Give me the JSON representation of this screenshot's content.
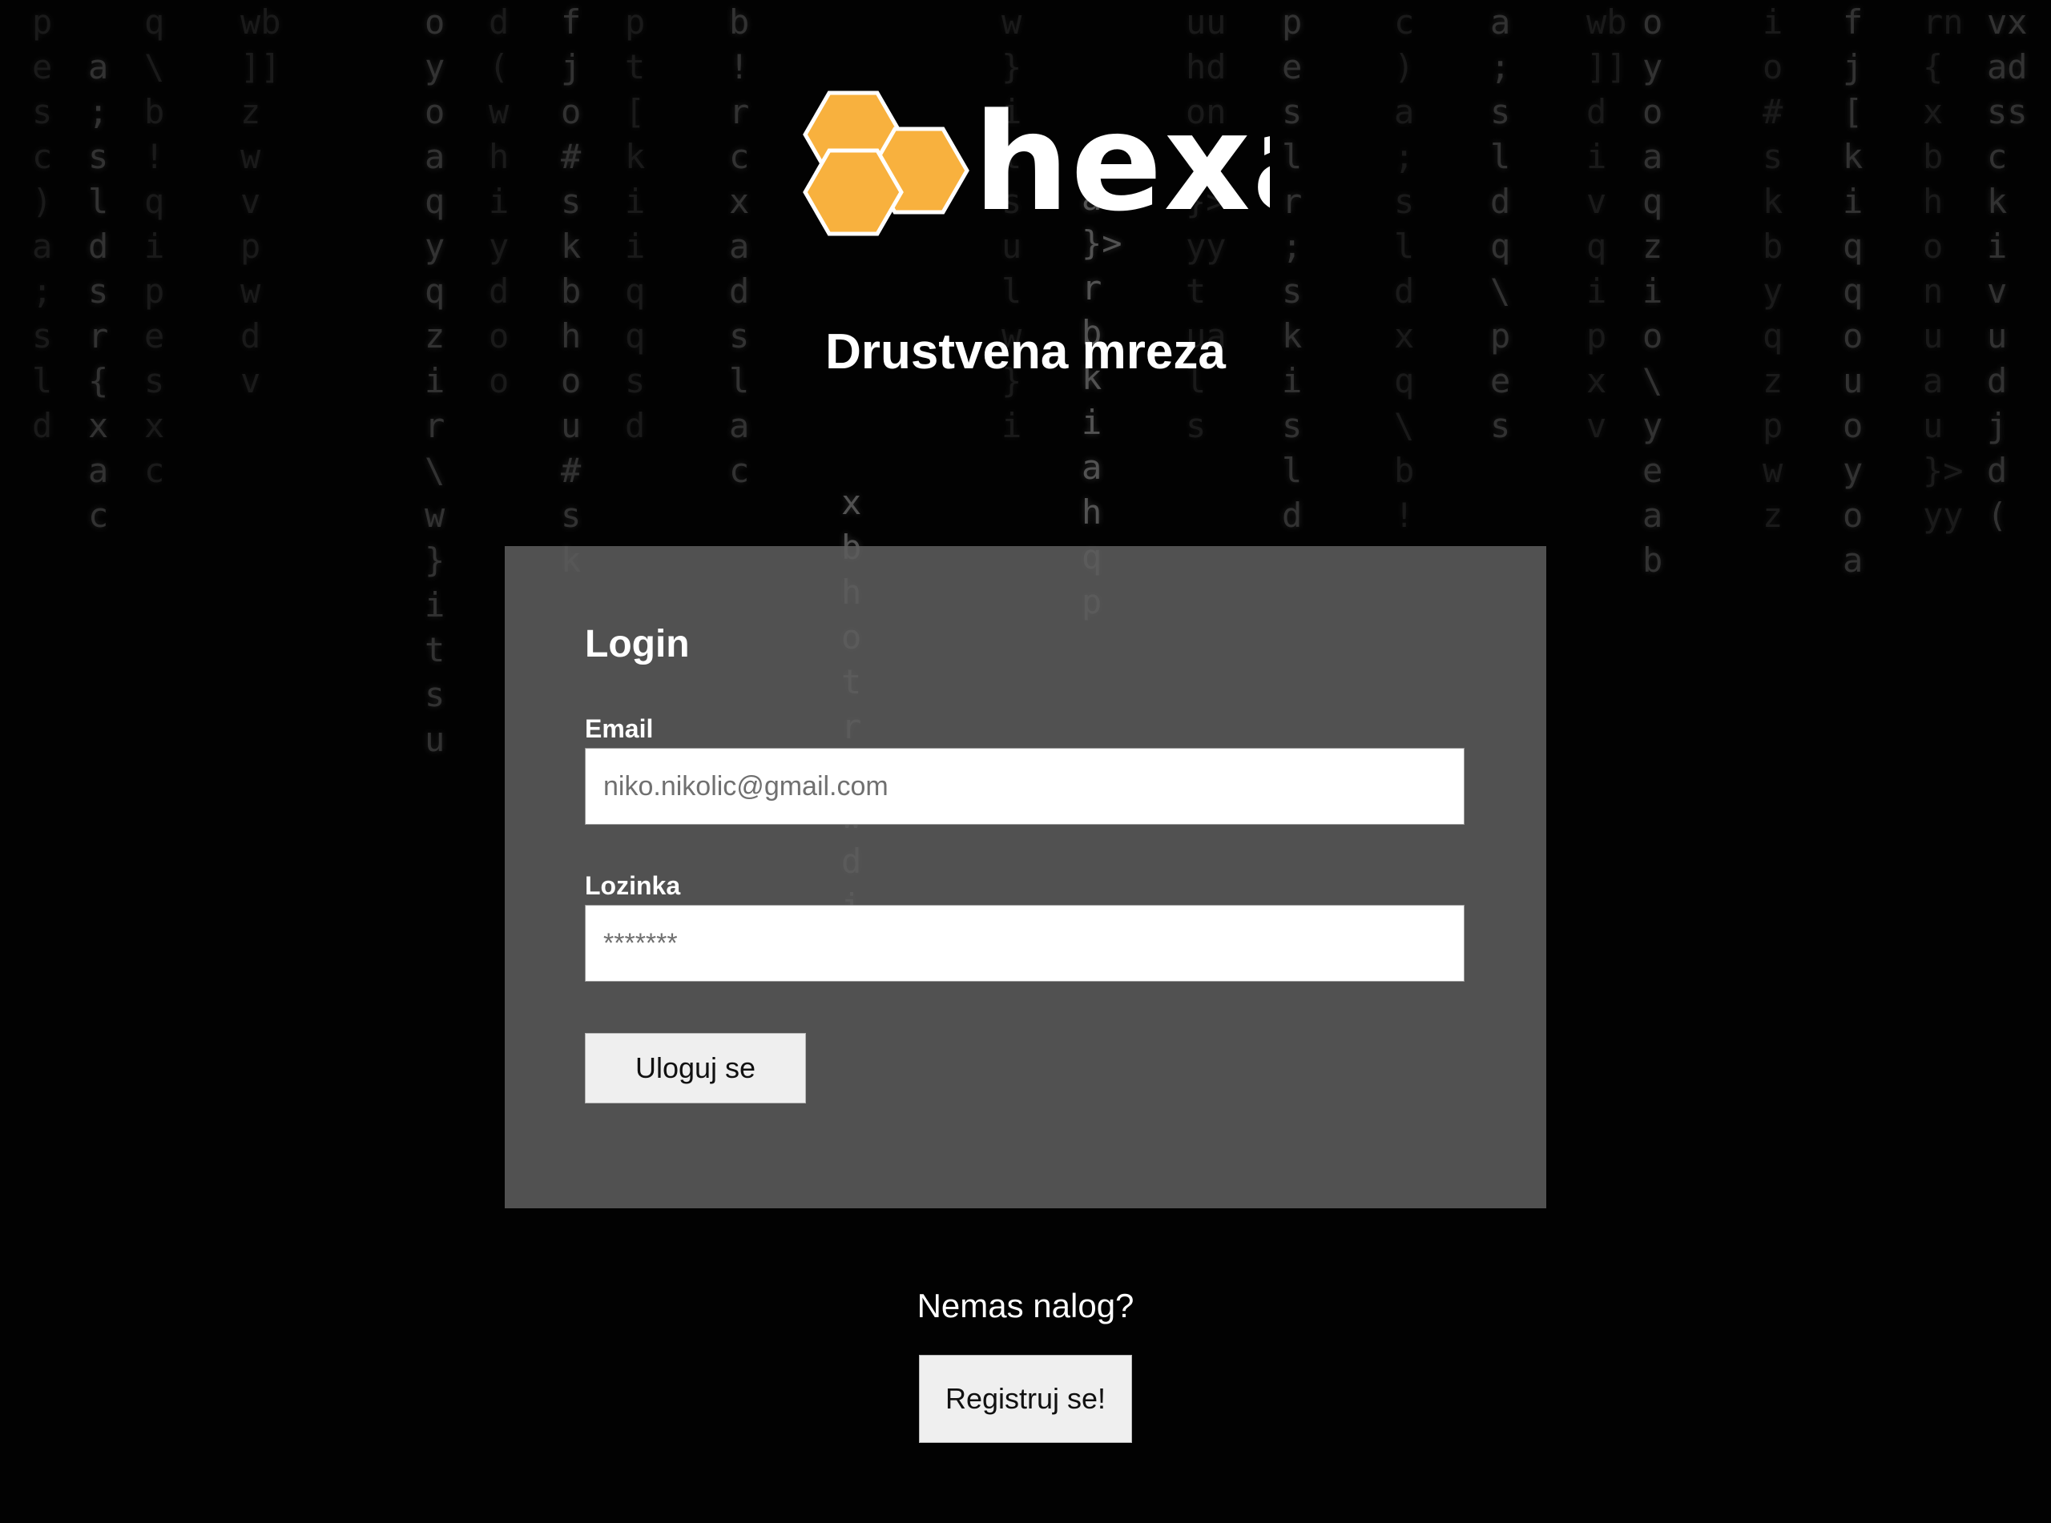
{
  "brand": {
    "name": "hexa",
    "logo_icon": "hexagon-cluster-icon",
    "logo_color": "#F8B13E"
  },
  "tagline": "Drustvena mreza",
  "login": {
    "title": "Login",
    "email_label": "Email",
    "email_placeholder": "niko.nikolic@gmail.com",
    "password_label": "Lozinka",
    "password_placeholder": "*******",
    "submit_label": "Uloguj se"
  },
  "register": {
    "prompt": "Nemas nalog?",
    "button_label": "Registruj se!"
  },
  "colors": {
    "background": "#000000",
    "panel": "#5C5C5C",
    "text": "#FFFFFF",
    "button": "#EFEFEF"
  }
}
